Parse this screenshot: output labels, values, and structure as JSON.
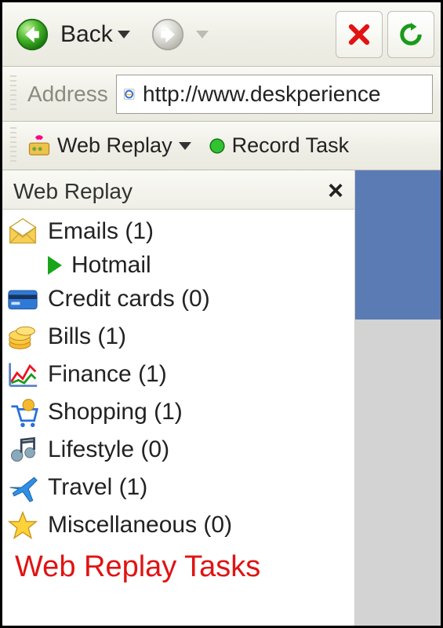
{
  "nav": {
    "back_label": "Back"
  },
  "address": {
    "label": "Address",
    "url": "http://www.deskperience"
  },
  "wr_toolbar": {
    "menu_label": "Web Replay",
    "record_label": "Record Task"
  },
  "panel": {
    "title": "Web Replay",
    "caption": "Web Replay Tasks",
    "categories": [
      {
        "label": "Emails (1)",
        "icon": "mail",
        "children": [
          {
            "label": "Hotmail"
          }
        ]
      },
      {
        "label": "Credit cards (0)",
        "icon": "creditcard",
        "children": []
      },
      {
        "label": "Bills (1)",
        "icon": "coins",
        "children": []
      },
      {
        "label": "Finance (1)",
        "icon": "finance",
        "children": []
      },
      {
        "label": "Shopping (1)",
        "icon": "shopping",
        "children": []
      },
      {
        "label": "Lifestyle (0)",
        "icon": "lifestyle",
        "children": []
      },
      {
        "label": "Travel (1)",
        "icon": "travel",
        "children": []
      },
      {
        "label": "Miscellaneous (0)",
        "icon": "star",
        "children": []
      }
    ]
  }
}
